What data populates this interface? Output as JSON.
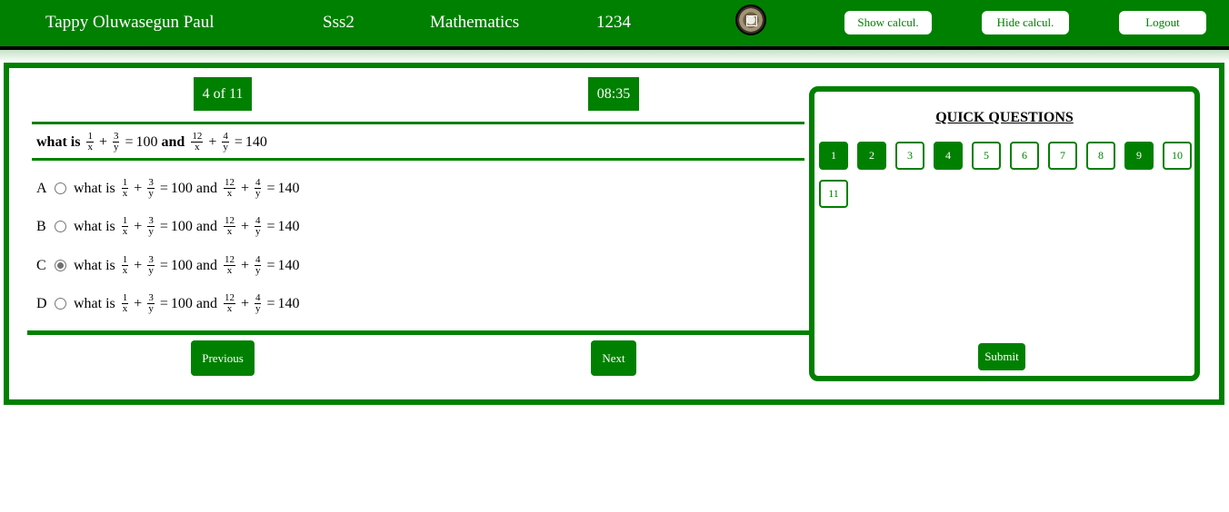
{
  "header": {
    "student_name": "Tappy Oluwasegun Paul",
    "class": "Sss2",
    "subject": "Mathematics",
    "code": "1234",
    "avatar": "student-photo",
    "show_calc_label": "Show calcul.",
    "hide_calc_label": "Hide calcul.",
    "logout_label": "Logout"
  },
  "exam": {
    "progress": "4 of 11",
    "timer": "08:35",
    "question": {
      "lead": "what is",
      "frac1_num": "1",
      "frac1_den": "x",
      "plus": "+",
      "frac2_num": "3",
      "frac2_den": "y",
      "eq1": "=",
      "val1": "100",
      "and": "and",
      "frac3_num": "12",
      "frac3_den": "x",
      "frac4_num": "4",
      "frac4_den": "y",
      "eq2": "=",
      "val2": "140"
    },
    "options": [
      {
        "letter": "A",
        "selected": false
      },
      {
        "letter": "B",
        "selected": false
      },
      {
        "letter": "C",
        "selected": true
      },
      {
        "letter": "D",
        "selected": false
      }
    ],
    "previous_label": "Previous",
    "next_label": "Next"
  },
  "quick_questions": {
    "title": "QUICK QUESTIONS",
    "items": [
      {
        "label": "1",
        "answered": true
      },
      {
        "label": "2",
        "answered": true
      },
      {
        "label": "3",
        "answered": false
      },
      {
        "label": "4",
        "answered": true
      },
      {
        "label": "5",
        "answered": false
      },
      {
        "label": "6",
        "answered": false
      },
      {
        "label": "7",
        "answered": false
      },
      {
        "label": "8",
        "answered": false
      },
      {
        "label": "9",
        "answered": true
      },
      {
        "label": "10",
        "answered": false
      },
      {
        "label": "11",
        "answered": false
      }
    ],
    "submit_label": "Submit"
  },
  "colors": {
    "primary": "#008000",
    "white": "#ffffff",
    "black": "#000000"
  }
}
